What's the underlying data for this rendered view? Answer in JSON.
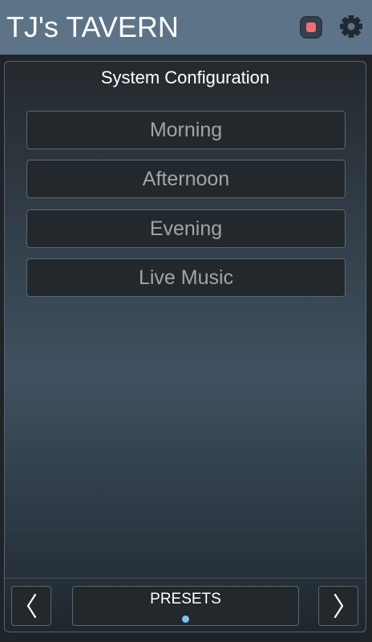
{
  "header": {
    "title": "TJ's TAVERN",
    "record_icon": "record-stop-icon",
    "settings_icon": "gear-icon"
  },
  "panel": {
    "title": "System Configuration",
    "presets": [
      {
        "label": "Morning"
      },
      {
        "label": "Afternoon"
      },
      {
        "label": "Evening"
      },
      {
        "label": "Live Music"
      }
    ]
  },
  "footer": {
    "prev_icon": "chevron-left-icon",
    "next_icon": "chevron-right-icon",
    "page_label": "PRESETS",
    "page_count": 1,
    "current_page": 1
  },
  "colors": {
    "header_bg": "#5d7488",
    "record_dot": "#f26f6f",
    "page_dot": "#7ec3f2",
    "button_text": "#a0a5a9"
  }
}
